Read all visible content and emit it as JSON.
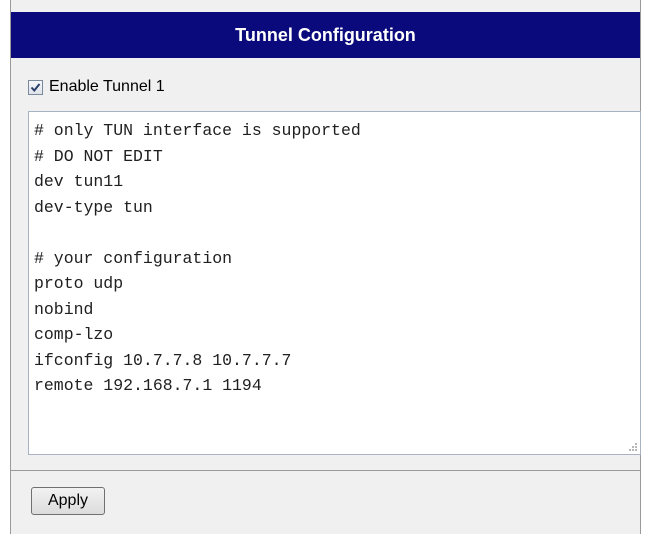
{
  "header": {
    "title": "Tunnel Configuration"
  },
  "enable": {
    "label": "Enable Tunnel 1",
    "checked": true
  },
  "config": {
    "text": "# only TUN interface is supported\n# DO NOT EDIT\ndev tun11\ndev-type tun\n\n# your configuration\nproto udp\nnobind\ncomp-lzo\nifconfig 10.7.7.8 10.7.7.7\nremote 192.168.7.1 1194"
  },
  "actions": {
    "apply_label": "Apply"
  },
  "colors": {
    "header_bg": "#0a0a7c",
    "panel_bg": "#f0f0f0"
  }
}
